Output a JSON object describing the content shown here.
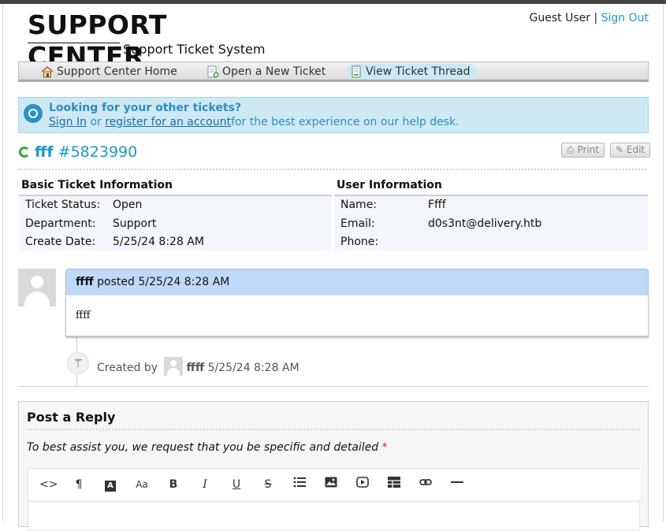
{
  "header": {
    "logo_title": "SUPPORT CENTER",
    "logo_subtitle": "Support Ticket System",
    "user_label": "Guest User",
    "separator": "|",
    "sign_out": "Sign Out"
  },
  "nav": {
    "items": [
      {
        "label": "Support Center Home",
        "icon": "home-icon"
      },
      {
        "label": "Open a New Ticket",
        "icon": "new-ticket-icon"
      },
      {
        "label": "View Ticket Thread",
        "icon": "ticket-thread-icon",
        "active": true
      }
    ]
  },
  "banner": {
    "title": "Looking for your other tickets?",
    "sign_in": "Sign In",
    "or": "or",
    "register": "register for an account",
    "suffix": "for the best experience on our help desk."
  },
  "ticket": {
    "subject": "fff",
    "number": "#5823990",
    "print_label": "Print",
    "edit_label": "Edit"
  },
  "basic_info": {
    "heading": "Basic Ticket Information",
    "rows": [
      {
        "label": "Ticket Status:",
        "value": "Open"
      },
      {
        "label": "Department:",
        "value": "Support"
      },
      {
        "label": "Create Date:",
        "value": "5/25/24 8:28 AM"
      }
    ]
  },
  "user_info": {
    "heading": "User Information",
    "rows": [
      {
        "label": "Name:",
        "value": "Ffff"
      },
      {
        "label": "Email:",
        "value": "d0s3nt@delivery.htb"
      },
      {
        "label": "Phone:",
        "value": ""
      }
    ]
  },
  "thread": {
    "author": "ffff",
    "posted_text": "posted 5/25/24 8:28 AM",
    "body": "ffff",
    "event_prefix": "Created by",
    "event_author": "ffff",
    "event_time": "5/25/24 8:28 AM"
  },
  "reply": {
    "title": "Post a Reply",
    "hint": "To best assist you, we request that you be specific and detailed",
    "required_mark": "*",
    "toolbar": [
      "code-view-icon",
      "paragraph-icon",
      "text-color-icon",
      "font-size-icon",
      "bold-icon",
      "italic-icon",
      "underline-icon",
      "strikethrough-icon",
      "list-icon",
      "image-icon",
      "video-icon",
      "table-icon",
      "link-icon",
      "horizontal-rule-icon"
    ]
  }
}
